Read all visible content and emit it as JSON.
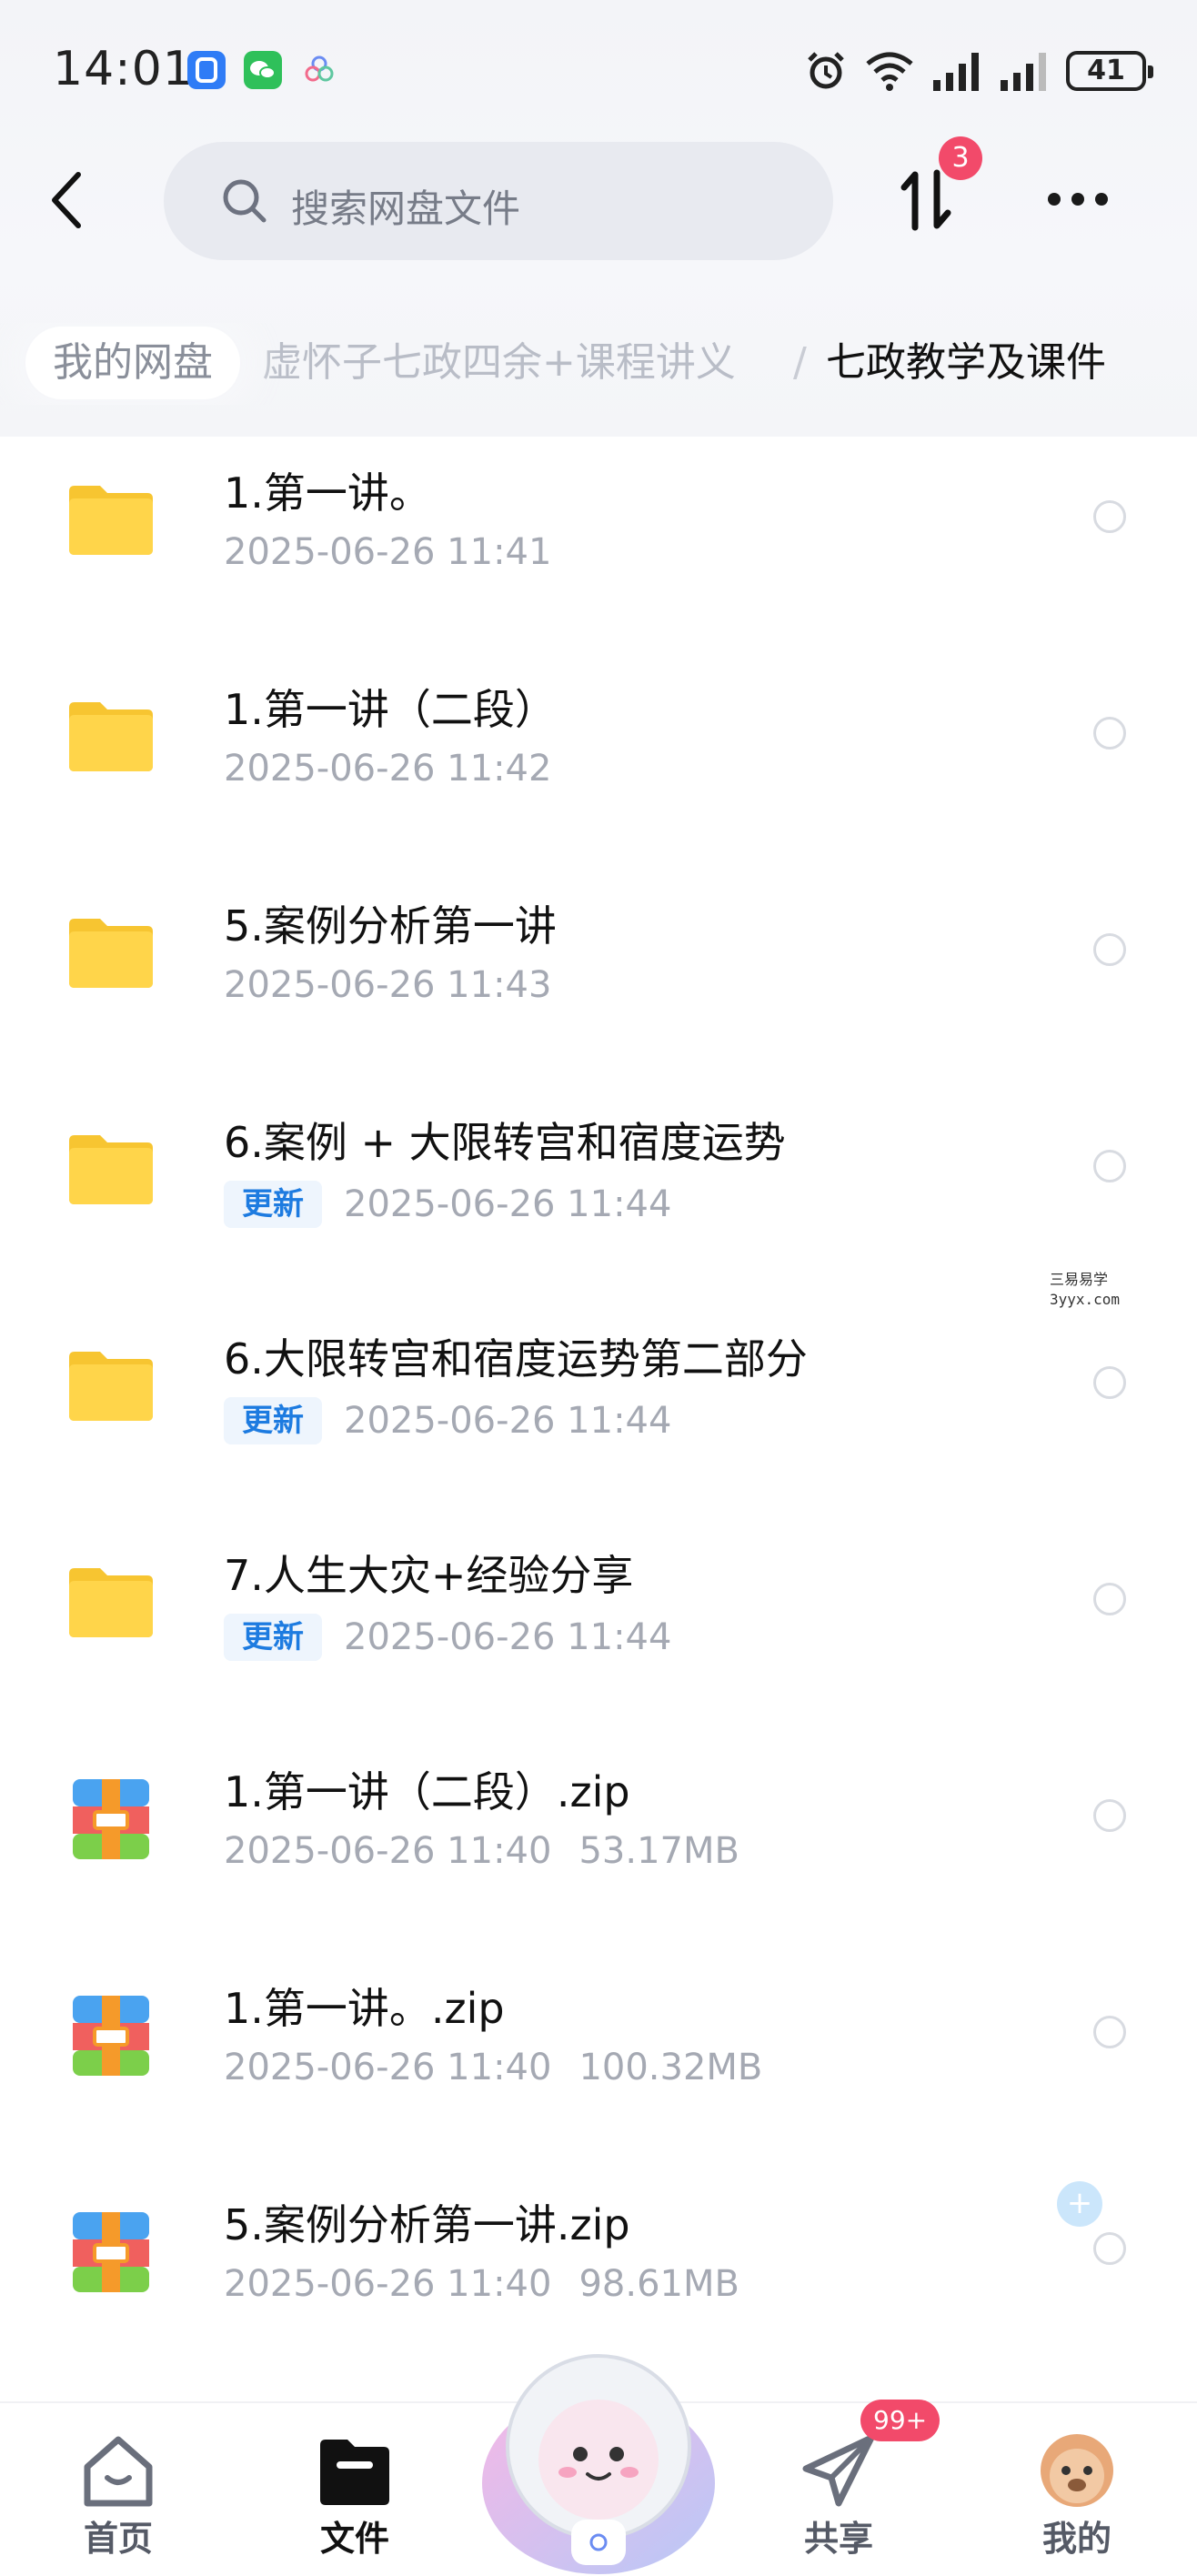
{
  "status_bar": {
    "time": "14:01",
    "battery": "41",
    "icons": [
      "alarm-icon",
      "wifi-icon",
      "signal-icon",
      "signal-icon",
      "battery-icon"
    ]
  },
  "header": {
    "search_placeholder": "搜索网盘文件",
    "transfer_badge": "3"
  },
  "breadcrumb": {
    "root": "我的网盘",
    "middle": "虚怀子七政四余+课程讲义",
    "separator": "/",
    "current": "七政教学及课件"
  },
  "files": [
    {
      "type": "folder",
      "name": "1.第一讲。",
      "date": "2025-06-26  11:41",
      "tag": "",
      "size": ""
    },
    {
      "type": "folder",
      "name": "1.第一讲（二段）",
      "date": "2025-06-26  11:42",
      "tag": "",
      "size": ""
    },
    {
      "type": "folder",
      "name": "5.案例分析第一讲",
      "date": "2025-06-26  11:43",
      "tag": "",
      "size": ""
    },
    {
      "type": "folder",
      "name": "6.案例 + 大限转宫和宿度运势",
      "date": "2025-06-26  11:44",
      "tag": "更新",
      "size": ""
    },
    {
      "type": "folder",
      "name": "6.大限转宫和宿度运势第二部分",
      "date": "2025-06-26  11:44",
      "tag": "更新",
      "size": ""
    },
    {
      "type": "folder",
      "name": "7.人生大灾+经验分享",
      "date": "2025-06-26  11:44",
      "tag": "更新",
      "size": ""
    },
    {
      "type": "zip",
      "name": "1.第一讲（二段）.zip",
      "date": "2025-06-26  11:40",
      "tag": "",
      "size": "53.17MB"
    },
    {
      "type": "zip",
      "name": "1.第一讲。.zip",
      "date": "2025-06-26  11:40",
      "tag": "",
      "size": "100.32MB"
    },
    {
      "type": "zip",
      "name": "5.案例分析第一讲.zip",
      "date": "2025-06-26  11:40",
      "tag": "",
      "size": "98.61MB"
    }
  ],
  "watermark": {
    "line1": "三易易学",
    "line2": "3yyx.com"
  },
  "bottom_nav": {
    "home": "首页",
    "files": "文件",
    "share": "共享",
    "share_badge": "99+",
    "mine": "我的"
  },
  "colors": {
    "accent": "#1d7be0",
    "badge": "#f24a6a",
    "folder": "#ffd54a"
  }
}
